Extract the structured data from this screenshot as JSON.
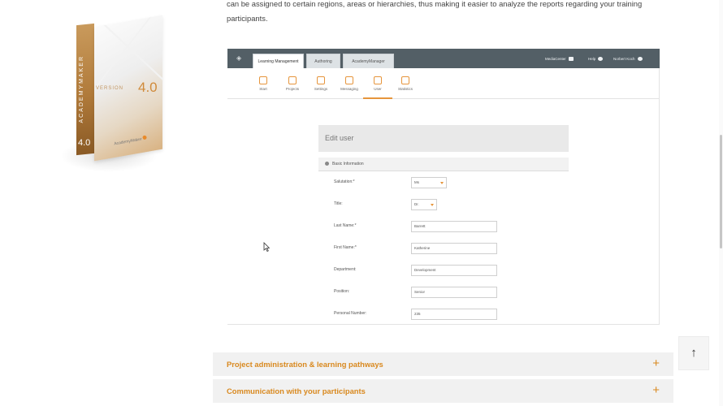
{
  "intro_text": "can be assigned to certain regions, areas or hierarchies, thus making it easier to analyze the reports regarding your training participants.",
  "product_box": {
    "spine_text": "ACADEMYMAKER",
    "spine_version": "4.0",
    "version_label": "VERSION",
    "version": "4.0",
    "brand": "AcademyMaker",
    "accent_color": "#d08a3a"
  },
  "app": {
    "tabs": [
      {
        "label": "Learning Management",
        "active": true
      },
      {
        "label": "Authoring",
        "active": false
      },
      {
        "label": "AcademyManager",
        "active": false
      }
    ],
    "top_right": [
      {
        "label": "MediaCenter",
        "icon": "folder-icon"
      },
      {
        "label": "Help",
        "icon": "help-icon"
      },
      {
        "label": "Norbert Koch",
        "icon": "user-circle-icon"
      }
    ],
    "nav": [
      {
        "label": "Start",
        "icon": "home-icon"
      },
      {
        "label": "Projects",
        "icon": "projects-icon"
      },
      {
        "label": "Settings",
        "icon": "settings-icon"
      },
      {
        "label": "Messaging",
        "icon": "messaging-icon"
      },
      {
        "label": "User",
        "icon": "user-icon",
        "active": true
      },
      {
        "label": "Statistics",
        "icon": "statistics-icon"
      }
    ],
    "edit_title": "Edit user",
    "section_title": "Basic Information",
    "fields": [
      {
        "label": "Salutation:*",
        "value": "Ms",
        "type": "select"
      },
      {
        "label": "Title:",
        "value": "Dr.",
        "type": "select"
      },
      {
        "label": "Last Name:*",
        "value": "Barrett",
        "type": "text"
      },
      {
        "label": "First Name:*",
        "value": "Katherine",
        "type": "text"
      },
      {
        "label": "Department:",
        "value": "Development",
        "type": "text"
      },
      {
        "label": "Position:",
        "value": "Senior",
        "type": "text"
      },
      {
        "label": "Personal Number:",
        "value": "235",
        "type": "text"
      }
    ],
    "accent_color": "#e6953c",
    "topbar_color": "#535f66"
  },
  "accordion": [
    {
      "title": "Project administration & learning pathways",
      "icon": "plus-icon"
    },
    {
      "title": "Communication with your participants",
      "icon": "plus-icon"
    }
  ],
  "scroll_top": {
    "icon": "arrow-up-icon",
    "glyph": "↑"
  }
}
